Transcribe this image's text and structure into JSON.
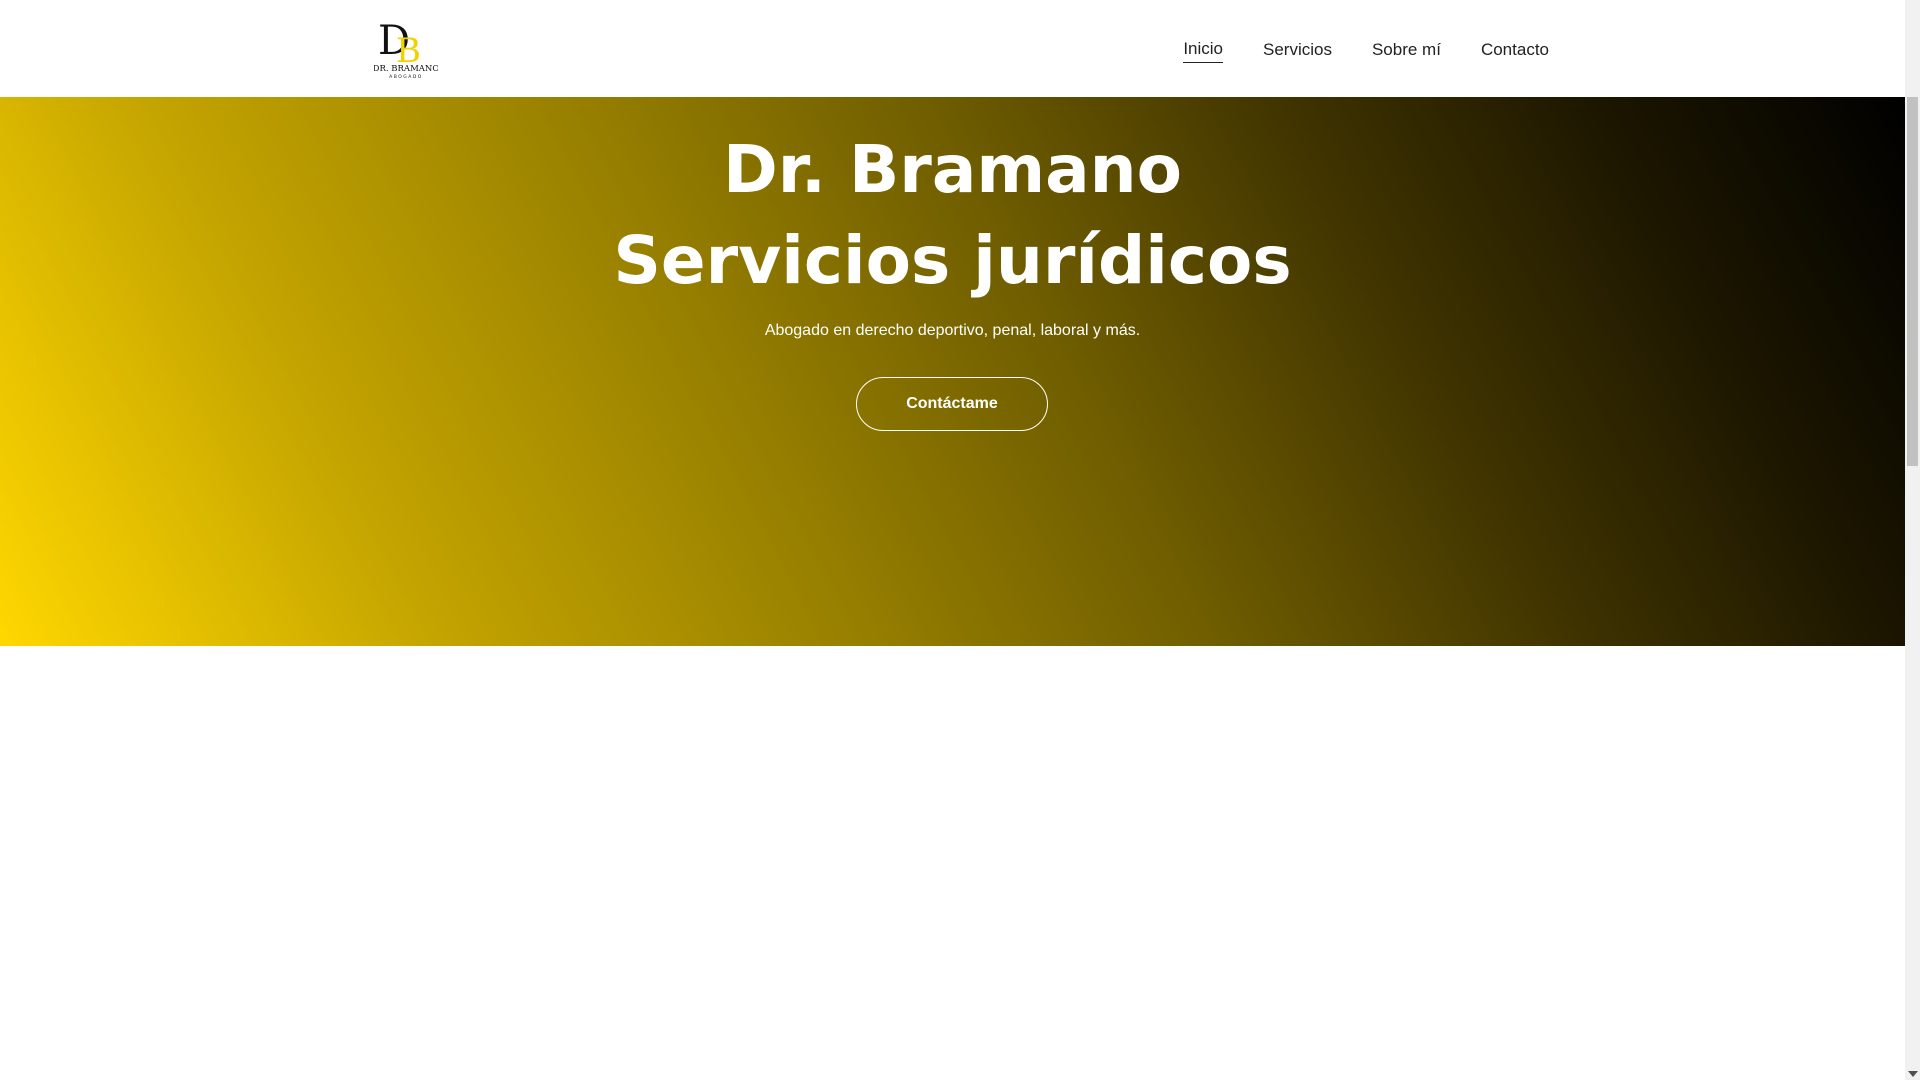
{
  "header": {
    "logo": {
      "monogram": "DB",
      "name": "DR. BRAMANO",
      "tagline": "ABOGADO"
    },
    "nav": [
      {
        "label": "Inicio",
        "active": true
      },
      {
        "label": "Servicios",
        "active": false
      },
      {
        "label": "Sobre mí",
        "active": false
      },
      {
        "label": "Contacto",
        "active": false
      }
    ]
  },
  "hero": {
    "title_line1": "Dr. Bramano",
    "title_line2": "Servicios jurídicos",
    "subtitle": "Abogado en derecho deportivo, penal, laboral y más.",
    "cta_label": "Contáctame",
    "gradient_colors": [
      "#ffd700",
      "#9a8200",
      "#000000"
    ]
  },
  "colors": {
    "accent": "#ffd700",
    "text_dark": "#222222",
    "text_light": "#ffffff"
  },
  "icons": {
    "scroll_down": "chevron-down-icon"
  }
}
